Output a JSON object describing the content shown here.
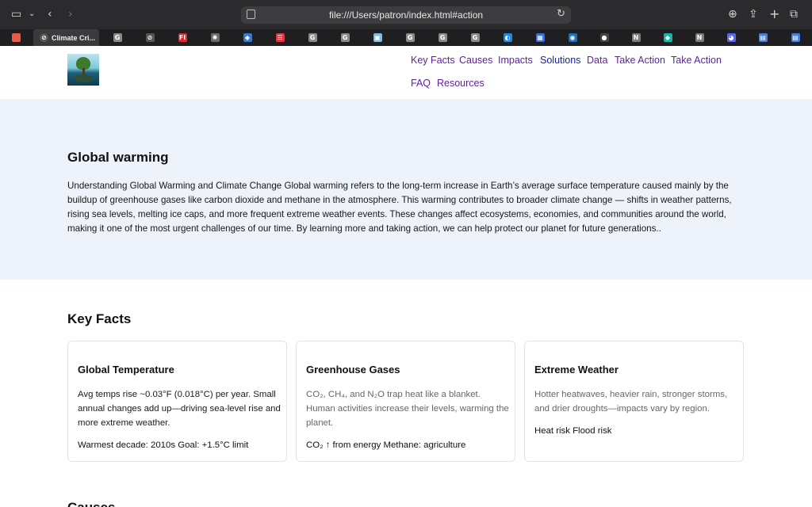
{
  "browser": {
    "url": "file:///Users/patron/index.html#action",
    "active_tab_title": "Climate Cri...",
    "tabs": [
      {
        "icon": "grid-favicon-icon",
        "color": "#e85b4a",
        "glyph": ""
      },
      {
        "icon": "google-icon",
        "color": "#8a8a8a",
        "glyph": "G"
      },
      {
        "icon": "compass-icon",
        "color": "#555555",
        "glyph": "⊘"
      },
      {
        "icon": "flipboard-icon",
        "color": "#e0262b",
        "glyph": "Fl"
      },
      {
        "icon": "openai-icon",
        "color": "#6a6a6a",
        "glyph": "✺"
      },
      {
        "icon": "shield-icon",
        "color": "#2f7bd6",
        "glyph": "◆"
      },
      {
        "icon": "reader-icon",
        "color": "#e0343f",
        "glyph": "☰"
      },
      {
        "icon": "google-icon",
        "color": "#8a8a8a",
        "glyph": "G"
      },
      {
        "icon": "google-icon",
        "color": "#8a8a8a",
        "glyph": "G"
      },
      {
        "icon": "doc-icon",
        "color": "#7fb9e6",
        "glyph": "▣"
      },
      {
        "icon": "google-icon",
        "color": "#8a8a8a",
        "glyph": "G"
      },
      {
        "icon": "google-icon",
        "color": "#8a8a8a",
        "glyph": "G"
      },
      {
        "icon": "google-icon",
        "color": "#8a8a8a",
        "glyph": "G"
      },
      {
        "icon": "edge-icon",
        "color": "#1e88e5",
        "glyph": "◐"
      },
      {
        "icon": "grid-icon",
        "color": "#3b6fd8",
        "glyph": "▦"
      },
      {
        "icon": "noaa-icon",
        "color": "#1c6fbf",
        "glyph": "◉"
      },
      {
        "icon": "github-icon",
        "color": "#444444",
        "glyph": "●"
      },
      {
        "icon": "notion-icon",
        "color": "#7a7a7a",
        "glyph": "N"
      },
      {
        "icon": "diamond-icon",
        "color": "#18b6a5",
        "glyph": "◆"
      },
      {
        "icon": "notion-icon",
        "color": "#7a7a7a",
        "glyph": "N"
      },
      {
        "icon": "discord-icon",
        "color": "#5865f2",
        "glyph": "◕"
      },
      {
        "icon": "calendar-icon",
        "color": "#4a7cd9",
        "glyph": "▤"
      },
      {
        "icon": "calendar-icon",
        "color": "#4a7cd9",
        "glyph": "▤"
      }
    ]
  },
  "nav": {
    "items": [
      {
        "label": "Key Facts",
        "current": false
      },
      {
        "label": "Causes",
        "current": false
      },
      {
        "label": "Impacts",
        "current": false
      },
      {
        "label": "Solutions",
        "current": true
      },
      {
        "label": "Data",
        "current": false
      },
      {
        "label": "Take Action",
        "current": false
      },
      {
        "label": "Take Action",
        "current": false
      },
      {
        "label": "FAQ",
        "current": false
      },
      {
        "label": "Resources",
        "current": false
      }
    ]
  },
  "hero": {
    "title": "Global warming",
    "text": "Understanding Global Warming and Climate Change Global warming refers to the long-term increase in Earth’s average surface temperature caused mainly by the buildup of greenhouse gases like carbon dioxide and methane in the atmosphere. This warming contributes to broader climate change — shifts in weather patterns, rising sea levels, melting ice caps, and more frequent extreme weather events. These changes affect ecosystems, economies, and communities around the world, making it one of the most urgent challenges of our time. By learning more and taking action, we can help protect our planet for future generations.."
  },
  "key_facts": {
    "title": "Key Facts",
    "cards": [
      {
        "title": "Global Temperature",
        "desc": "Avg temps rise ~0.03°F (0.018°C) per year. Small annual changes add up—driving sea-level rise and more extreme weather.",
        "tags": "Warmest decade: 2010s Goal: +1.5°C limit"
      },
      {
        "title": "Greenhouse Gases",
        "desc": "CO₂, CH₄, and N₂O trap heat like a blanket. Human activities increase their levels, warming the planet.",
        "tags": "CO₂ ↑ from energy Methane: agriculture"
      },
      {
        "title": "Extreme Weather",
        "desc": "Hotter heatwaves, heavier rain, stronger storms, and drier droughts—impacts vary by region.",
        "tags": "Heat risk Flood risk"
      }
    ]
  },
  "causes": {
    "title": "Causes"
  }
}
